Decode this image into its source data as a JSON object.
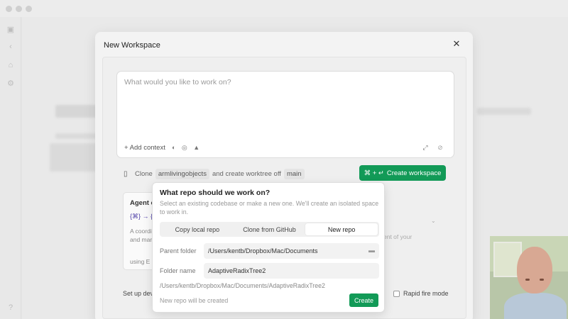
{
  "modal": {
    "title": "New Workspace",
    "close_icon": "close-icon"
  },
  "prompt": {
    "placeholder": "What would you like to work on?",
    "add_context": "+  Add context"
  },
  "clone_row": {
    "clone_label": "Clone",
    "repo": "armlivingobjects",
    "middle_text": "and create worktree off",
    "branch": "main"
  },
  "create_workspace": {
    "shortcut": "⌘ + ↵",
    "label": "Create workspace"
  },
  "agent_card": {
    "title": "Agent o",
    "icons": "{⌘} → {",
    "desc_line1": "A coordi",
    "desc_line2": "and man",
    "using": "using  E"
  },
  "side_text": "ent of your",
  "setup": {
    "label": "Set up dev"
  },
  "rapid_fire": {
    "label": "Rapid fire mode",
    "checked": false
  },
  "popover": {
    "title": "What repo should we work on?",
    "description": "Select an existing codebase or make a new one. We'll create an isolated space to work in.",
    "tabs": [
      {
        "label": "Copy local repo",
        "active": false
      },
      {
        "label": "Clone from GitHub",
        "active": false
      },
      {
        "label": "New repo",
        "active": true
      }
    ],
    "parent_folder_label": "Parent folder",
    "parent_folder_value": "/Users/kentb/Dropbox/Mac/Documents",
    "folder_name_label": "Folder name",
    "folder_name_value": "AdaptiveRadixTree2",
    "full_path": "/Users/kentb/Dropbox/Mac/Documents/AdaptiveRadixTree2",
    "status": "New repo will be created",
    "create_label": "Create"
  },
  "colors": {
    "accent": "#129a57",
    "background": "#e9e9e9"
  }
}
